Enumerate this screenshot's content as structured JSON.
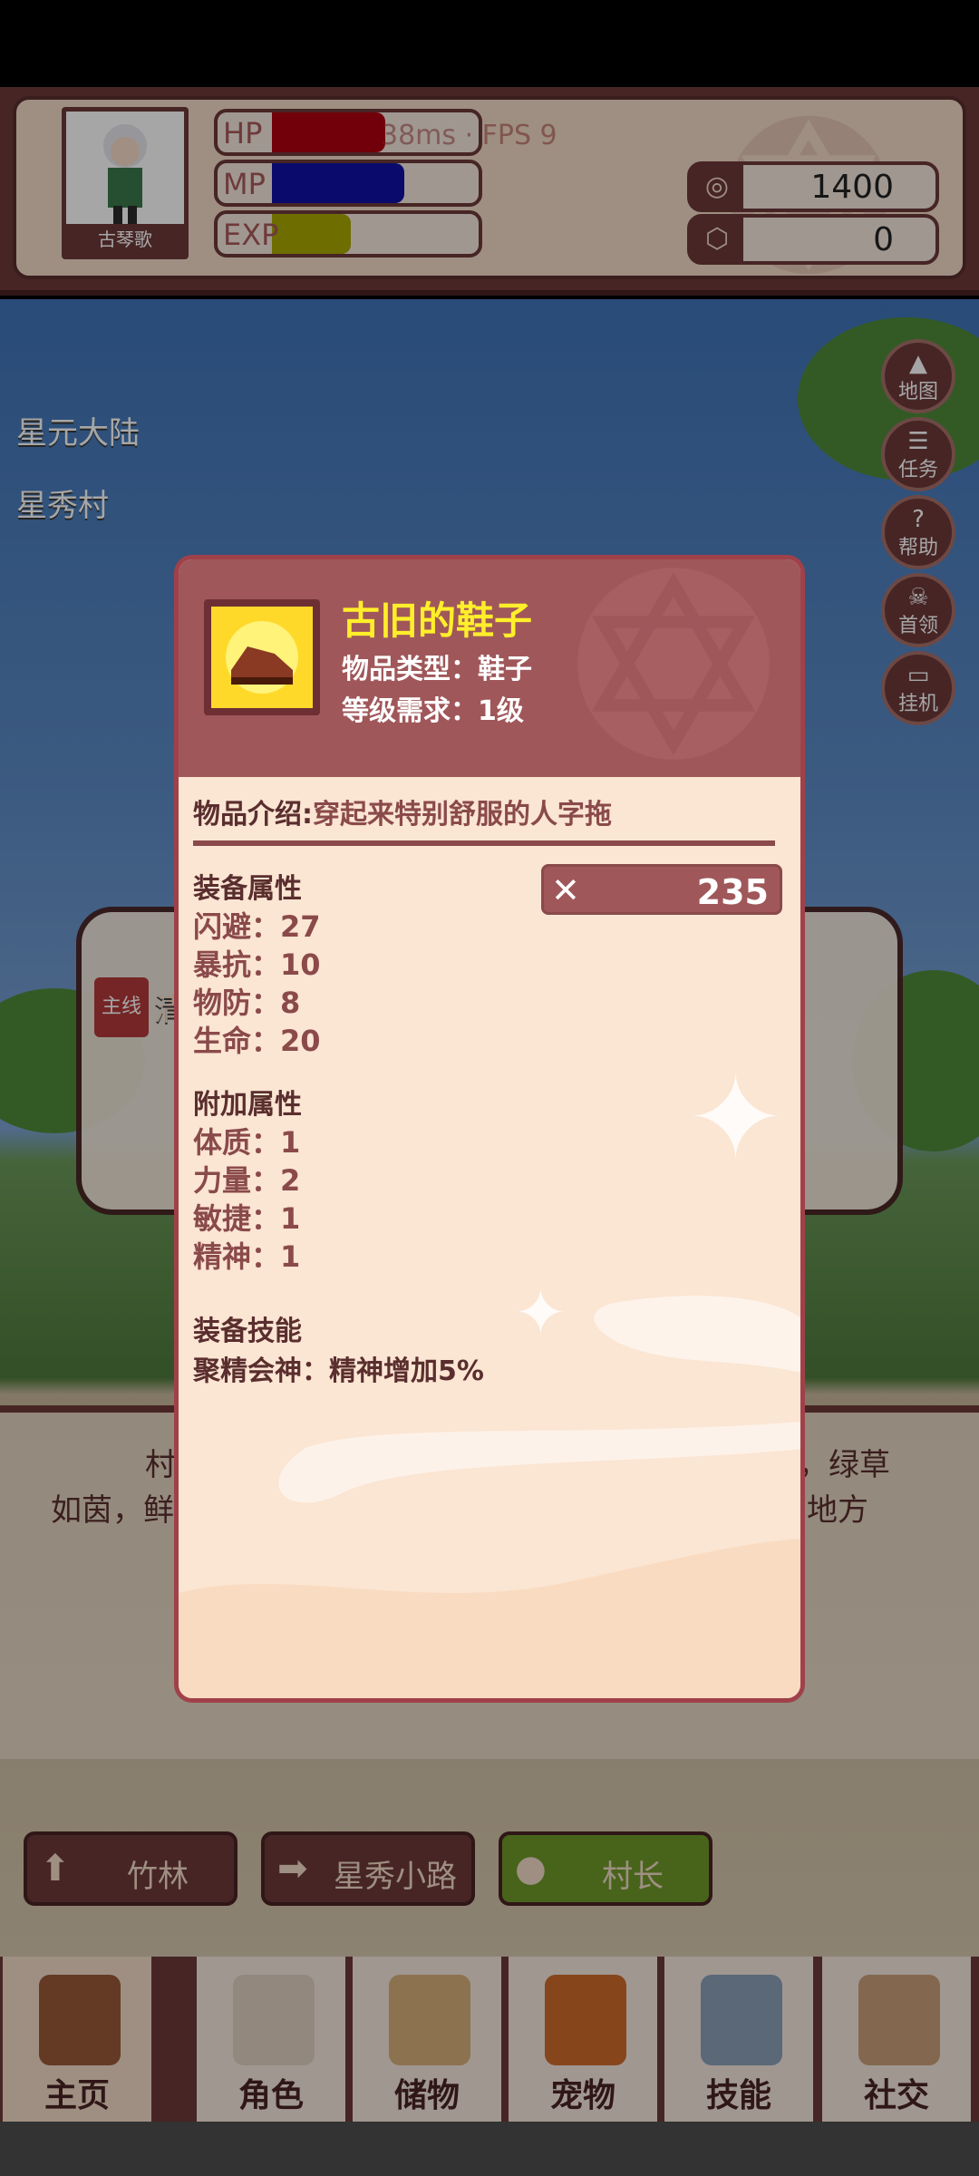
{
  "player": {
    "name": "古琴歌",
    "hp_label": "HP",
    "mp_label": "MP",
    "exp_label": "EXP",
    "hp_fraction": 0.55,
    "mp_fraction": 0.64,
    "exp_fraction": 0.38,
    "hp_color": "#b00010",
    "mp_color": "#1010a8",
    "exp_color": "#a8a800"
  },
  "perf": {
    "text": "38ms · FPS 9"
  },
  "currency": [
    {
      "icon": "coin-icon",
      "value": "1400"
    },
    {
      "icon": "gem-icon",
      "value": "0"
    }
  ],
  "location": {
    "region": "星元大陆",
    "village": "星秀村"
  },
  "side_buttons": [
    {
      "icon": "map-icon",
      "glyph": "▲",
      "label": "地图"
    },
    {
      "icon": "quest-icon",
      "glyph": "☰",
      "label": "任务"
    },
    {
      "icon": "help-icon",
      "glyph": "?",
      "label": "帮助"
    },
    {
      "icon": "boss-icon",
      "glyph": "☠",
      "label": "首领"
    },
    {
      "icon": "idle-icon",
      "glyph": "▭",
      "label": "挂机"
    }
  ],
  "background_text": {
    "quest_tag": "主线",
    "quest_peek": "清",
    "desc_line1_left": "村",
    "desc_line1_right": "，绿草",
    "desc_line2_left": "如茵，鲜",
    "desc_line2_right": "地方"
  },
  "nav_buttons": [
    {
      "icon": "up-arrow-icon",
      "glyph": "⬆",
      "label": "竹林"
    },
    {
      "icon": "right-arrow-icon",
      "glyph": "➡",
      "label": "星秀小路"
    },
    {
      "icon": "person-icon",
      "glyph": "●",
      "label": "村长"
    }
  ],
  "tabs": [
    {
      "label": "主页",
      "icon": "home-gate-icon",
      "color": "#9a5a3a"
    },
    {
      "label": "角色",
      "icon": "character-icon",
      "color": "#e2d2c0"
    },
    {
      "label": "储物",
      "icon": "bag-icon",
      "color": "#d8b07a"
    },
    {
      "label": "宠物",
      "icon": "fox-pet-icon",
      "color": "#d06a2a"
    },
    {
      "label": "技能",
      "icon": "sword-icon",
      "color": "#8aa0b8"
    },
    {
      "label": "社交",
      "icon": "handshake-icon",
      "color": "#c9a07a"
    }
  ],
  "item": {
    "name": "古旧的鞋子",
    "type_line": "物品类型：鞋子",
    "level_line": "等级需求：1级",
    "intro_label": "物品介绍:",
    "intro_value": "穿起来特别舒服的人字拖",
    "power": "235",
    "equip_title": "装备属性",
    "equip_stats": [
      "闪避：27",
      "暴抗：10",
      "物防：8",
      "生命：20"
    ],
    "extra_title": "附加属性",
    "extra_stats": [
      "体质：1",
      "力量：2",
      "敏捷：1",
      "精神：1"
    ],
    "skill_title": "装备技能",
    "skill_line": "聚精会神：精神增加5%"
  }
}
